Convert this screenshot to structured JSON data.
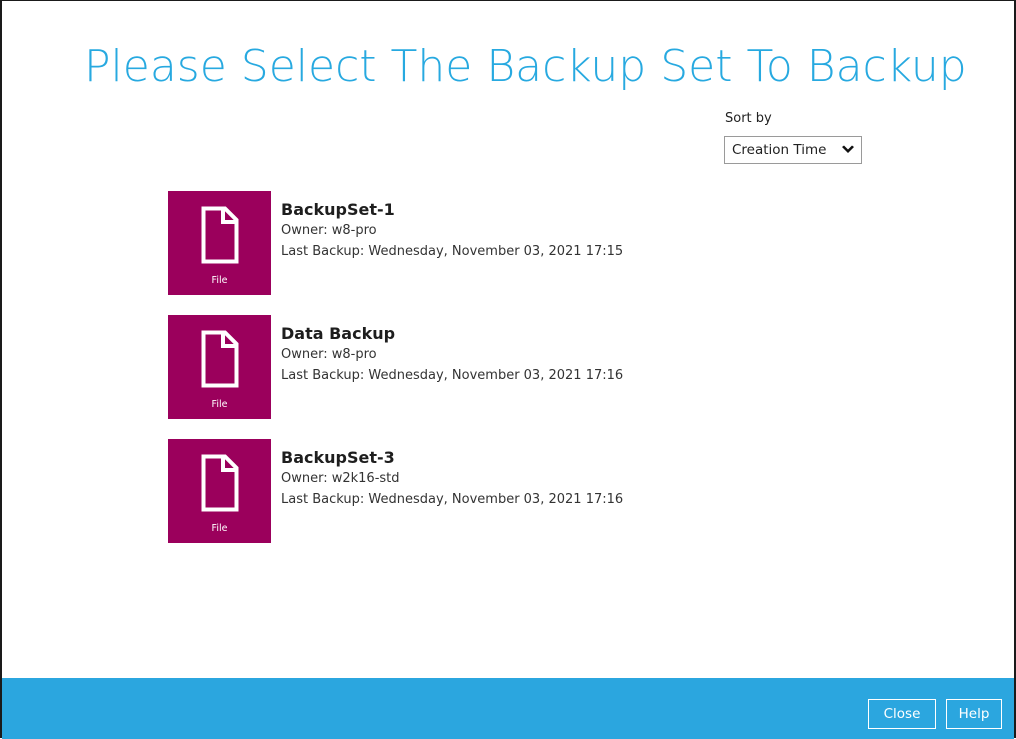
{
  "title": "Please Select The Backup Set To Backup",
  "sort": {
    "label": "Sort by",
    "selected": "Creation Time",
    "icon": "chevron-down-icon"
  },
  "backup_sets": [
    {
      "name": "BackupSet-1",
      "owner": "Owner: w8-pro",
      "last_backup": "Last Backup: Wednesday, November 03, 2021 17:15",
      "type": "File",
      "icon": "file-icon"
    },
    {
      "name": "Data Backup",
      "owner": "Owner: w8-pro",
      "last_backup": "Last Backup: Wednesday, November 03, 2021 17:16",
      "type": "File",
      "icon": "file-icon"
    },
    {
      "name": "BackupSet-3",
      "owner": "Owner: w2k16-std",
      "last_backup": "Last Backup: Wednesday, November 03, 2021 17:16",
      "type": "File",
      "icon": "file-icon"
    }
  ],
  "footer": {
    "close_label": "Close",
    "help_label": "Help"
  },
  "colors": {
    "title": "#27a9e0",
    "tile": "#9b005c",
    "footer": "#2ba6df"
  }
}
